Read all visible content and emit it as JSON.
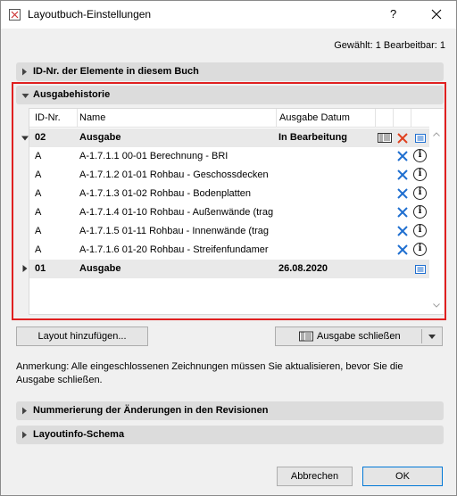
{
  "window": {
    "title": "Layoutbuch-Einstellungen",
    "help_label": "?",
    "close_label": "✕"
  },
  "status": "Gewählt: 1 Bearbeitbar: 1",
  "sections": {
    "id_section": "ID-Nr. der Elemente in diesem Buch",
    "history_section": "Ausgabehistorie",
    "numbering_section": "Nummerierung der Änderungen in den Revisionen",
    "layoutinfo_section": "Layoutinfo-Schema"
  },
  "table": {
    "headers": [
      "ID-Nr.",
      "Name",
      "Ausgabe Datum"
    ],
    "issue_02": {
      "id": "02",
      "name": "Ausgabe",
      "date": "In Bearbeitung"
    },
    "rows": [
      {
        "id": "A",
        "name": "A-1.7.1.1 00-01 Berechnung - BRI"
      },
      {
        "id": "A",
        "name": "A-1.7.1.2 01-01 Rohbau - Geschossdecken"
      },
      {
        "id": "A",
        "name": "A-1.7.1.3 01-02 Rohbau - Bodenplatten"
      },
      {
        "id": "A",
        "name": "A-1.7.1.4 01-10 Rohbau - Außenwände (trag"
      },
      {
        "id": "A",
        "name": "A-1.7.1.5 01-11 Rohbau - Innenwände (trag"
      },
      {
        "id": "A",
        "name": "A-1.7.1.6 01-20 Rohbau - Streifenfundamer"
      }
    ],
    "issue_01": {
      "id": "01",
      "name": "Ausgabe",
      "date": "26.08.2020"
    }
  },
  "buttons": {
    "add_layout": "Layout hinzufügen...",
    "close_issue": "Ausgabe schließen",
    "cancel": "Abbrechen",
    "ok": "OK"
  },
  "note": "Anmerkung: Alle eingeschlossenen Zeichnungen müssen Sie aktualisieren, bevor Sie die Ausgabe schließen.",
  "icons": {
    "delete": "x-icon",
    "info": "info-icon",
    "list": "list-icon",
    "issue": "issue-book-icon"
  },
  "colors": {
    "highlight_frame": "#e02020",
    "accent_blue": "#1f6fd0",
    "delete_red": "#e0401e"
  },
  "info_glyph": "i"
}
